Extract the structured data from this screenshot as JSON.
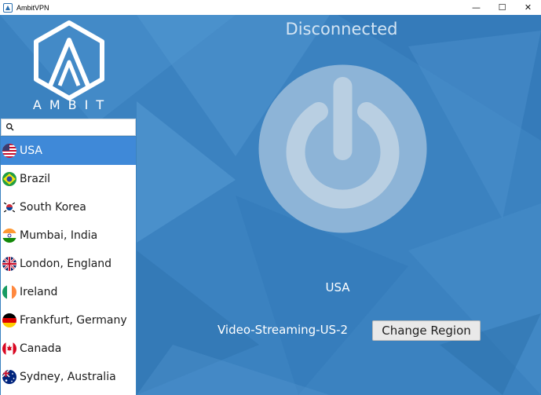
{
  "window": {
    "title": "AmbitVPN",
    "minimize_glyph": "—",
    "maximize_glyph": "☐",
    "close_glyph": "✕"
  },
  "brand": {
    "name": "AMBIT"
  },
  "search": {
    "placeholder": "",
    "value": ""
  },
  "regions": [
    {
      "label": "USA",
      "flag": "us-flag-icon",
      "selected": true
    },
    {
      "label": "Brazil",
      "flag": "brazil-flag-icon",
      "selected": false
    },
    {
      "label": "South Korea",
      "flag": "south-korea-flag-icon",
      "selected": false
    },
    {
      "label": "Mumbai, India",
      "flag": "india-flag-icon",
      "selected": false
    },
    {
      "label": "London, England",
      "flag": "uk-flag-icon",
      "selected": false
    },
    {
      "label": "Ireland",
      "flag": "ireland-flag-icon",
      "selected": false
    },
    {
      "label": "Frankfurt, Germany",
      "flag": "germany-flag-icon",
      "selected": false
    },
    {
      "label": "Canada",
      "flag": "canada-flag-icon",
      "selected": false
    },
    {
      "label": "Sydney, Australia",
      "flag": "australia-flag-icon",
      "selected": false
    }
  ],
  "connection": {
    "status": "Disconnected",
    "region": "USA",
    "server": "Video-Streaming-US-2",
    "change_region_label": "Change Region"
  },
  "colors": {
    "background": "#3b82c0",
    "selected_item": "#3f89d8",
    "status_text": "#d3e4f3"
  }
}
